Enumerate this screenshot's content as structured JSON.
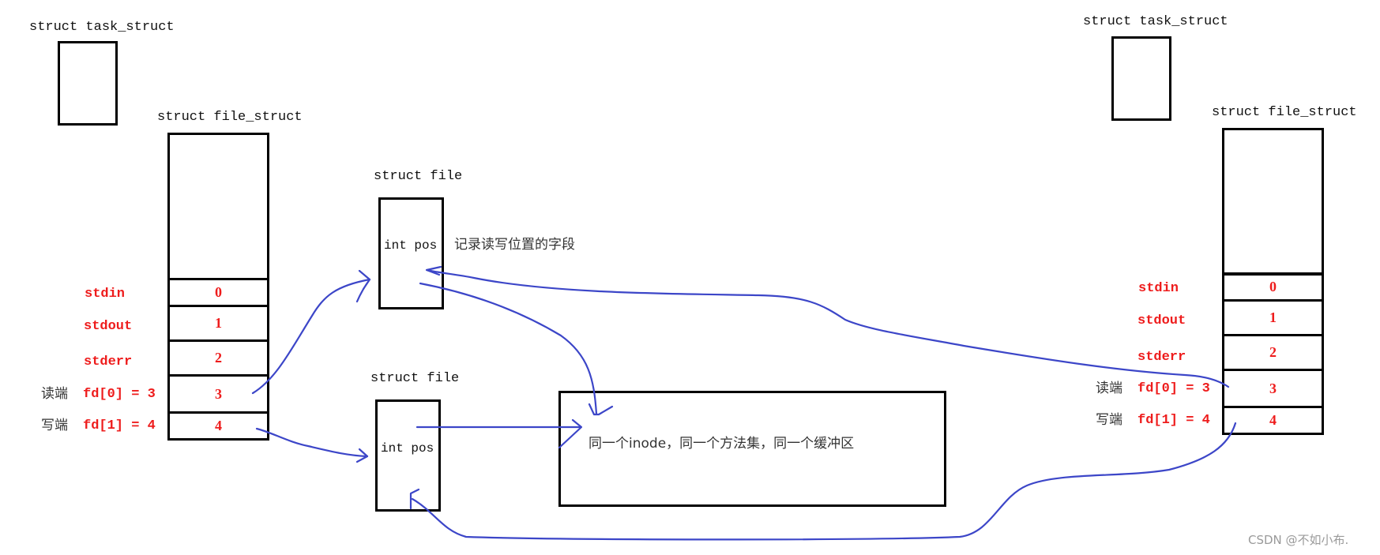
{
  "left": {
    "task_struct_label": "struct task_struct",
    "file_struct_label": "struct file_struct",
    "fd_rows": [
      {
        "name": "stdin",
        "index": "0"
      },
      {
        "name": "stdout",
        "index": "1"
      },
      {
        "name": "stderr",
        "index": "2"
      },
      {
        "name": "fd[0] = 3",
        "role": "读端",
        "index": "3"
      },
      {
        "name": "fd[1] = 4",
        "role": "写端",
        "index": "4"
      }
    ]
  },
  "middle": {
    "file_top": {
      "label": "struct file",
      "field": "int pos",
      "note": "记录读写位置的字段"
    },
    "file_bottom": {
      "label": "struct file",
      "field": "int pos"
    },
    "inode_text": "同一个inode，同一个方法集，同一个缓冲区"
  },
  "right": {
    "task_struct_label": "struct task_struct",
    "file_struct_label": "struct file_struct",
    "fd_rows": [
      {
        "name": "stdin",
        "index": "0"
      },
      {
        "name": "stdout",
        "index": "1"
      },
      {
        "name": "stderr",
        "index": "2"
      },
      {
        "name": "fd[0] = 3",
        "role": "读端",
        "index": "3"
      },
      {
        "name": "fd[1] = 4",
        "role": "写端",
        "index": "4"
      }
    ]
  },
  "colors": {
    "arrow": "#3c46c8",
    "fd_text": "#ee1c1c",
    "box": "#000000"
  },
  "watermark": "CSDN @不如小布."
}
